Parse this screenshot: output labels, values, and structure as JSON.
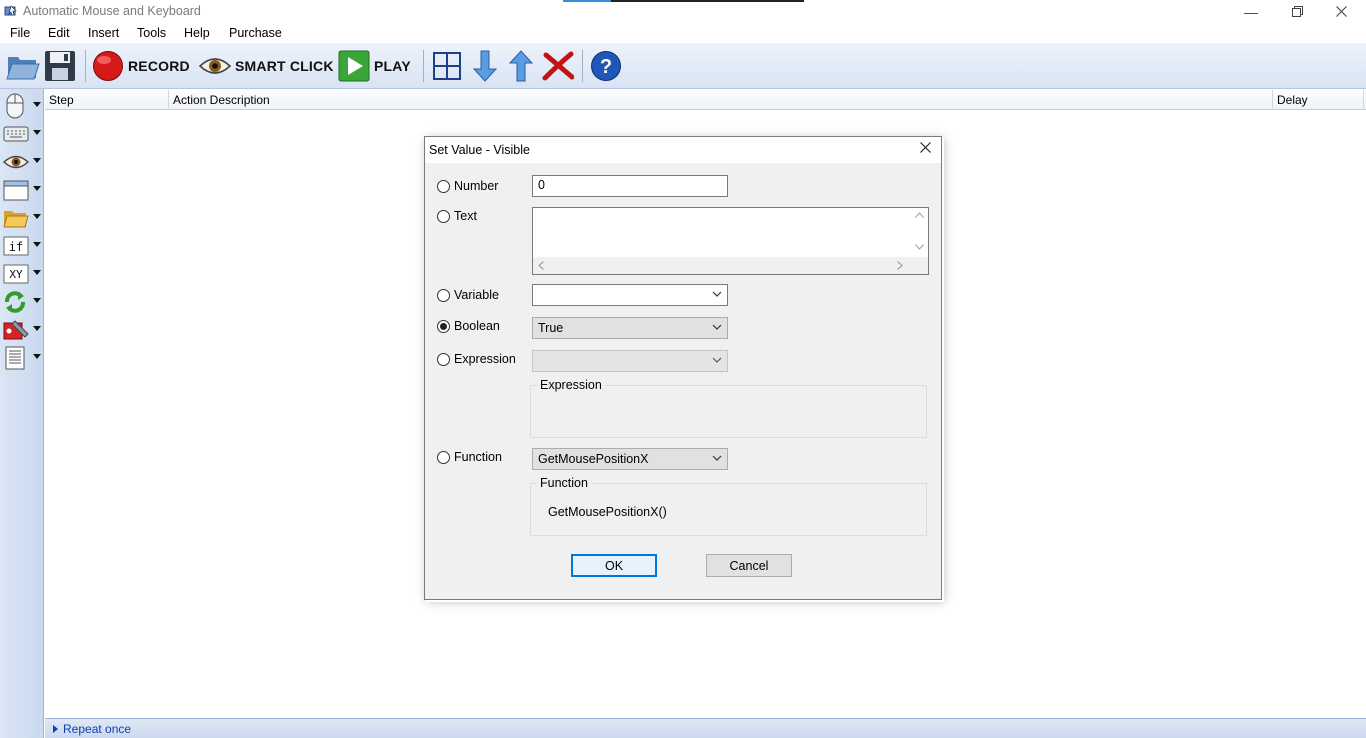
{
  "window": {
    "title": "Automatic Mouse and Keyboard",
    "icons": [
      "app-icon",
      "minimize-icon",
      "restore-icon",
      "close-icon"
    ]
  },
  "menu": [
    "File",
    "Edit",
    "Insert",
    "Tools",
    "Help",
    "Purchase"
  ],
  "toolbar": {
    "record_label": "RECORD",
    "smart_click_label": "SMART CLICK",
    "play_label": "PLAY",
    "icons": [
      "open-folder-icon",
      "save-disk-icon",
      "record-icon",
      "eye-icon",
      "play-icon",
      "select-region-icon",
      "move-down-icon",
      "move-up-icon",
      "delete-icon",
      "help-icon"
    ]
  },
  "sidebar": {
    "icons": [
      "mouse-icon",
      "keyboard-icon",
      "eye-icon",
      "window-icon",
      "folder-icon",
      "if-icon",
      "xy-icon",
      "loop-icon",
      "tools-icon",
      "script-icon"
    ],
    "if_label": "if",
    "xy_label": "XY"
  },
  "grid": {
    "columns": [
      "Step",
      "Action Description",
      "Delay"
    ]
  },
  "status": {
    "repeat_label": "Repeat once"
  },
  "dialog": {
    "title": "Set Value - Visible",
    "options": {
      "number": "Number",
      "text": "Text",
      "variable": "Variable",
      "boolean": "Boolean",
      "expression": "Expression",
      "function": "Function"
    },
    "selected_option": "Boolean",
    "number_value": "0",
    "text_value": "",
    "variable_value": "",
    "boolean_value": "True",
    "expression_value": "",
    "expression_group_label": "Expression",
    "function_value": "GetMousePositionX",
    "function_group_label": "Function",
    "function_preview": "GetMousePositionX()",
    "ok_label": "OK",
    "cancel_label": "Cancel"
  },
  "colors": {
    "accent_blue": "#0078d7",
    "toolbar_bg": "#dde7f5",
    "record_red": "#d61a1a",
    "play_green": "#3aa63a",
    "status_link": "#0b3fb5"
  }
}
